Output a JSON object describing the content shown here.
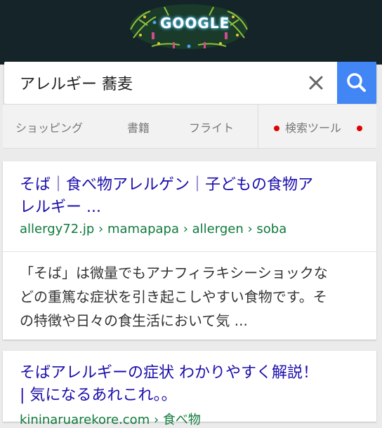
{
  "header": {
    "doodle_label": "GOOGLE",
    "colors": {
      "background": "#142428",
      "doodle_glow": "#6cd5ff"
    }
  },
  "search": {
    "query": "アレルギー 蕎麦",
    "clear_label": "×",
    "icons": {
      "clear": "close-icon",
      "submit": "search-icon"
    },
    "accent_color": "#4285f4"
  },
  "tabs": {
    "items": [
      {
        "label": "ショッピング"
      },
      {
        "label": "書籍"
      },
      {
        "label": "フライト"
      }
    ],
    "tools_label": "検索ツール",
    "tools_dot_color": "#e00000"
  },
  "results": [
    {
      "title_line1": "そば｜食べ物アレルゲン｜子どもの食物ア",
      "title_line2": "レルギー ...",
      "url": "allergy72.jp › mamapapa › allergen › soba",
      "snippet_line1": "「そば」は微量でもアナフィラキシーショックな",
      "snippet_line2": "どの重篤な症状を引き起こしやすい食物です。そ",
      "snippet_line3": "の特徴や日々の食生活において気 ..."
    },
    {
      "title_line1": "そばアレルギーの症状 わかりやすく解説！",
      "title_line2": "| 気になるあれこれ。。",
      "url": "kininaruarekore.com › 食べ物"
    }
  ],
  "link_color": "#1a0dab",
  "url_color": "#0f7a3c"
}
